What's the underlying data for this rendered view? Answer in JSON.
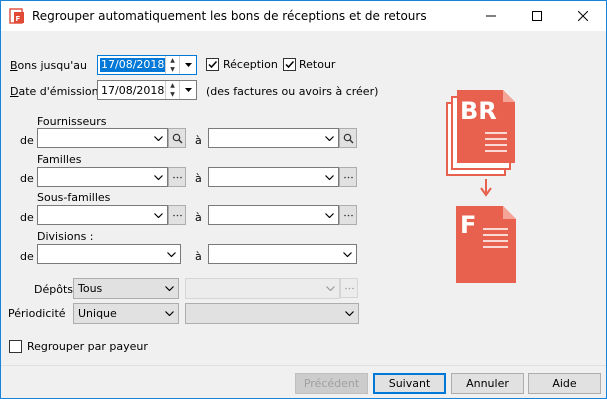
{
  "window": {
    "title": "Regrouper automatiquement les bons de réceptions et de retours"
  },
  "form": {
    "bons_label_u": "B",
    "bons_label_rest": "ons jusqu'au",
    "bons_date": "17/08/2018",
    "reception_label": "Réception",
    "retour_label": "Retour",
    "emission_label_u": "D",
    "emission_label_rest": "ate d'émission",
    "emission_date": "17/08/2018",
    "emission_note": "(des factures ou avoirs à créer)",
    "fournisseurs_title": "Fournisseurs",
    "familles_title": "Familles",
    "sousfamilles_title": "Sous-familles",
    "divisions_title": "Divisions :",
    "de": "de",
    "a": "à",
    "depots_label": "Dépôts",
    "depots_value": "Tous",
    "periodicite_label": "Périodicité",
    "periodicite_value": "Unique",
    "regrouper_label": "Regrouper par payeur"
  },
  "illustration": {
    "top_doc": "BR",
    "bottom_doc": "F"
  },
  "buttons": {
    "precedent": "Précédent",
    "suivant": "Suivant",
    "annuler": "Annuler",
    "aide": "Aide"
  },
  "colors": {
    "accent": "#0078d7",
    "doc": "#e8614e"
  }
}
